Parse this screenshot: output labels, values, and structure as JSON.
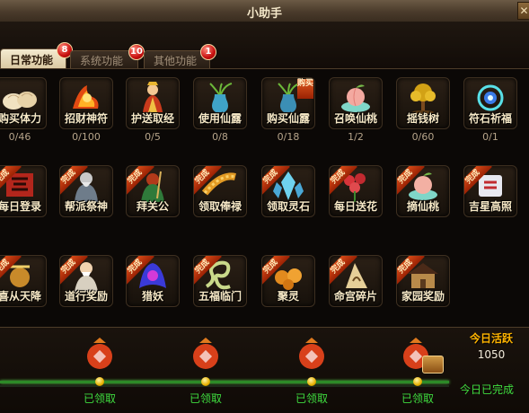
{
  "window": {
    "title": "小助手",
    "close_symbol": "✕"
  },
  "tabs": [
    {
      "label": "日常功能",
      "badge": "8",
      "active": true
    },
    {
      "label": "系统功能",
      "badge": "10",
      "active": false
    },
    {
      "label": "其他功能",
      "badge": "1",
      "active": false
    }
  ],
  "tiles_row1": [
    {
      "label": "购买体力",
      "count": "0/46",
      "icon": "steamed-buns-icon"
    },
    {
      "label": "招财神符",
      "count": "0/100",
      "icon": "fire-talisman-icon"
    },
    {
      "label": "护送取经",
      "count": "0/5",
      "icon": "monk-escort-icon"
    },
    {
      "label": "使用仙露",
      "count": "0/8",
      "icon": "dew-vase-icon"
    },
    {
      "label": "购买仙露",
      "count": "0/18",
      "icon": "dew-vase-icon",
      "tag": "购买"
    },
    {
      "label": "召唤仙桃",
      "count": "1/2",
      "icon": "peach-bowl-icon"
    },
    {
      "label": "摇钱树",
      "count": "0/60",
      "icon": "money-tree-icon"
    },
    {
      "label": "符石祈福",
      "count": "0/1",
      "icon": "rune-stone-icon"
    }
  ],
  "tiles_row2": [
    {
      "label": "每日登录",
      "icon": "login-scroll-icon",
      "tag": "完成"
    },
    {
      "label": "帮派祭神",
      "icon": "guild-god-icon",
      "tag": "完成"
    },
    {
      "label": "拜关公",
      "icon": "guan-gong-icon",
      "tag": "完成"
    },
    {
      "label": "领取俸禄",
      "icon": "salary-coins-icon",
      "tag": "完成"
    },
    {
      "label": "领取灵石",
      "icon": "spirit-stone-icon",
      "tag": "完成"
    },
    {
      "label": "每日送花",
      "icon": "flower-icon",
      "tag": "完成"
    },
    {
      "label": "摘仙桃",
      "icon": "peach-bowl-icon",
      "tag": "完成"
    },
    {
      "label": "吉星高照",
      "icon": "lucky-star-icon",
      "tag": "完成"
    }
  ],
  "tiles_row3": [
    {
      "label": "喜从天降",
      "icon": "joy-gift-icon",
      "tag": "完成"
    },
    {
      "label": "道行奖励",
      "icon": "taoist-elder-icon",
      "tag": "完成"
    },
    {
      "label": "猎妖",
      "icon": "demon-hunt-icon",
      "tag": "完成"
    },
    {
      "label": "五福临门",
      "icon": "dragon-icon",
      "tag": "完成"
    },
    {
      "label": "聚灵",
      "icon": "spirit-orbs-icon",
      "tag": "完成"
    },
    {
      "label": "命宫碎片",
      "icon": "fate-fragment-icon",
      "tag": "完成"
    },
    {
      "label": "家园奖励",
      "icon": "house-icon",
      "tag": "完成"
    }
  ],
  "activity": {
    "title": "今日活跃",
    "value": "1050",
    "status": "今日已完成",
    "rewards": [
      {
        "status": "已领取"
      },
      {
        "status": "已领取"
      },
      {
        "status": "已领取"
      },
      {
        "status": "已领取"
      }
    ]
  }
}
